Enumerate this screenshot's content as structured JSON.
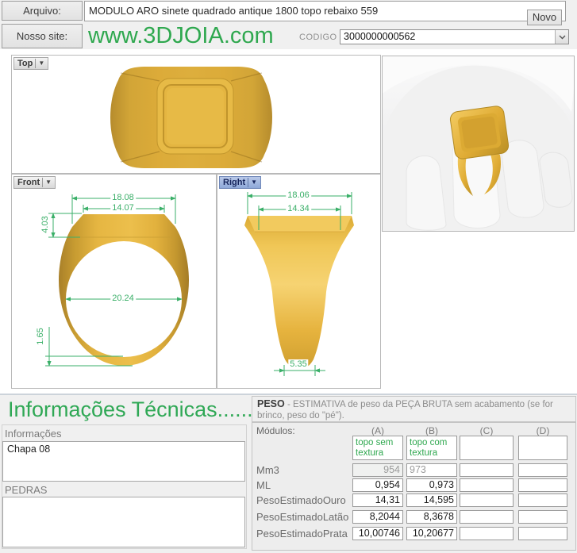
{
  "header": {
    "arquivo_label": "Arquivo:",
    "file_name": "MODULO ARO sinete quadrado antique 1800 topo rebaixo 559",
    "novo_label": "Novo",
    "site_label": "Nosso site:",
    "site_url": "www.3DJOIA.com",
    "codigo_label": "CODIGO",
    "codigo_value": "3000000000562"
  },
  "viewports": {
    "top": {
      "label": "Top"
    },
    "front": {
      "label": "Front",
      "dims": {
        "outer_width": "18.08",
        "inner_width": "14.07",
        "head_height": "4.03",
        "inner_diameter": "20.24",
        "band_thickness": "1.65"
      }
    },
    "right": {
      "label": "Right",
      "dims": {
        "outer_width": "18.06",
        "inner_width": "14.34",
        "tip_width": "5.35"
      }
    }
  },
  "tech": {
    "title": "Informações Técnicas.......",
    "peso_bold": "PESO",
    "peso_rest": " -  ESTIMATIVA de peso da PEÇA BRUTA sem acabamento (se for brinco, peso do \"pé\").",
    "informacoes_label": "Informações",
    "informacoes_value": "Chapa 08",
    "pedras_label": "PEDRAS",
    "pedras_value": ""
  },
  "table": {
    "modulos_label": "Módulos:",
    "columns": [
      "(A)",
      "(B)",
      "(C)",
      "(D)"
    ],
    "header_row": [
      "topo sem textura",
      "topo com textura",
      "",
      ""
    ],
    "rows": [
      {
        "label": "Mm3",
        "values": [
          "954",
          "973",
          "",
          ""
        ]
      },
      {
        "label": "ML",
        "values": [
          "0,954",
          "0,973",
          "",
          ""
        ]
      },
      {
        "label": "PesoEstimadoOuro",
        "values": [
          "14,31",
          "14,595",
          "",
          ""
        ]
      },
      {
        "label": "PesoEstimadoLatão",
        "values": [
          "8,2044",
          "8,3678",
          "",
          ""
        ]
      },
      {
        "label": "PesoEstimadoPrata",
        "values": [
          "10,00746",
          "10,20677",
          "",
          ""
        ]
      }
    ]
  },
  "colors": {
    "brand_green": "#2fa84f",
    "dimension_green": "#3aaf68",
    "gold": "#e3af3d",
    "active_tab_blue": "#8ea9d9"
  }
}
